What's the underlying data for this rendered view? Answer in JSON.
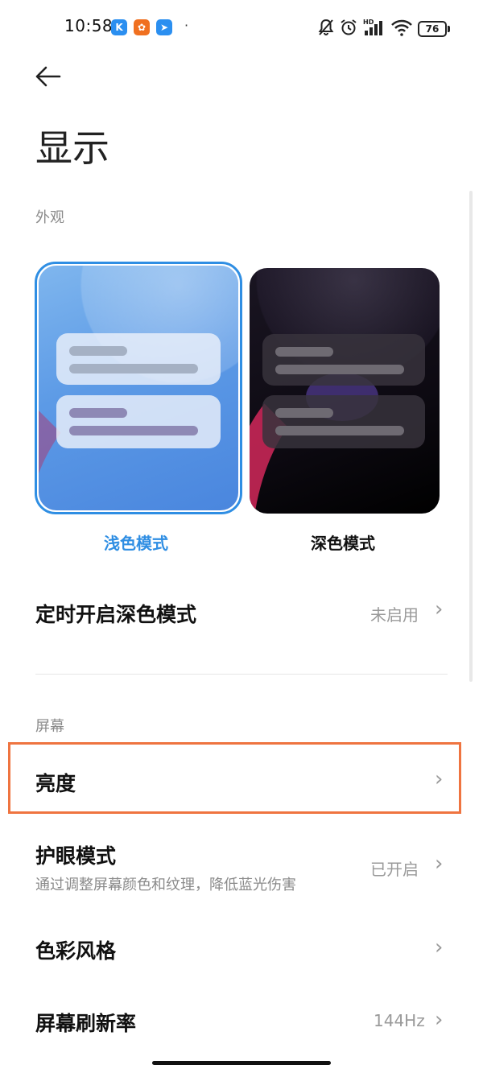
{
  "status_bar": {
    "time": "10:58",
    "battery": "76",
    "apps": [
      {
        "icon": "k-app-icon",
        "glyph": "K",
        "color": "#2b8ff0"
      },
      {
        "icon": "orange-app-icon",
        "glyph": "器",
        "color": "#f07020"
      },
      {
        "icon": "send-app-icon",
        "glyph": "➤",
        "color": "#2b8ff0"
      }
    ],
    "dot": "·",
    "hd_label": "HD"
  },
  "nav": {
    "back_icon": "back-arrow-icon"
  },
  "page": {
    "title": "显示"
  },
  "appearance": {
    "header": "外观",
    "light_label": "浅色模式",
    "dark_label": "深色模式",
    "accent": "#2f8ee3"
  },
  "dark_schedule": {
    "title": "定时开启深色模式",
    "value": "未启用"
  },
  "screen": {
    "header": "屏幕",
    "brightness": {
      "title": "亮度"
    },
    "eye_care": {
      "title": "护眼模式",
      "subtitle": "通过调整屏幕颜色和纹理，降低蓝光伤害",
      "value": "已开启"
    },
    "color_style": {
      "title": "色彩风格"
    },
    "refresh_rate": {
      "title": "屏幕刷新率",
      "value": "144Hz"
    }
  },
  "chevron": "›",
  "highlight_color": "#ef7440"
}
